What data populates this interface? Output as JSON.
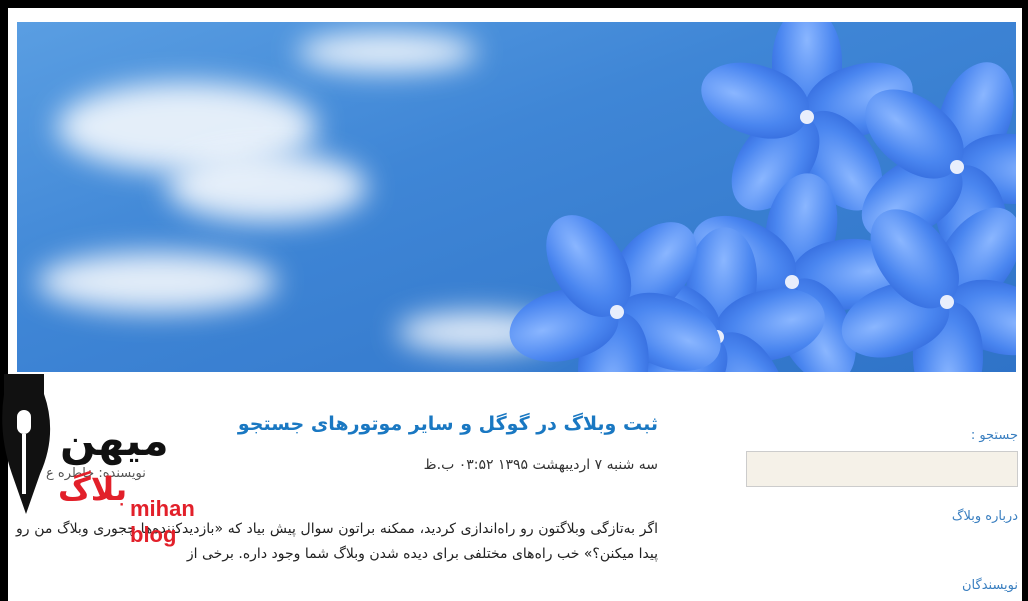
{
  "post": {
    "title": "ثبت وبلاگ در گوگل و سایر موتورهای جستجو",
    "meta": "سه شنبه ۷ اردیبهشت ۱۳۹۵ ۰۳:۵۲ ب.ظ",
    "body": "اگر به‌تازگی وبلاگتون رو راه‌اندازی کردید، ممکنه براتون سوال پیش بیاد که «بازدیدکننده‌ها چجوری وبلاگ من رو پیدا میکنن؟» خب راه‌های مختلفی برای دیده شدن وبلاگ شما وجود داره. برخی از",
    "author_partial": "نویسنده: خاطره ع"
  },
  "sidebar": {
    "search_label": "جستجو :",
    "about_link": "درباره وبلاگ",
    "authors_link": "نویسندگان"
  },
  "logo": {
    "fa_top": "میهن",
    "fa_bottom": "بلاگ",
    "en": "mihan blog"
  },
  "colors": {
    "link": "#1a78c2",
    "logo_red": "#e2202a",
    "search_bg": "#f5f1e8"
  }
}
